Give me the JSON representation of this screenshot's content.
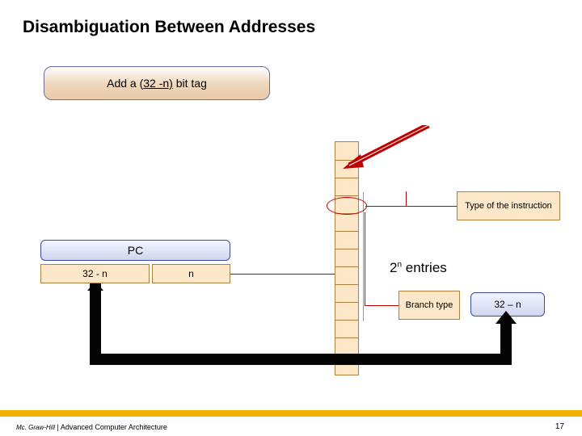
{
  "title": "Disambiguation Between Addresses",
  "callout_prefix": "Add a (",
  "callout_underlined": "32 -n)",
  "callout_suffix": " bit tag",
  "type_instruction": "Type of the instruction",
  "pc_label": "PC",
  "pc_left": "32 - n",
  "pc_right": "n",
  "entries_prefix": "2",
  "entries_sup": "n",
  "entries_suffix": " entries",
  "branch_type": "Branch type",
  "target": "32 – n",
  "footer_pub": "Mc. Graw-Hill",
  "footer_sep": " | ",
  "footer_course": "Advanced Computer Architecture",
  "page": "17"
}
